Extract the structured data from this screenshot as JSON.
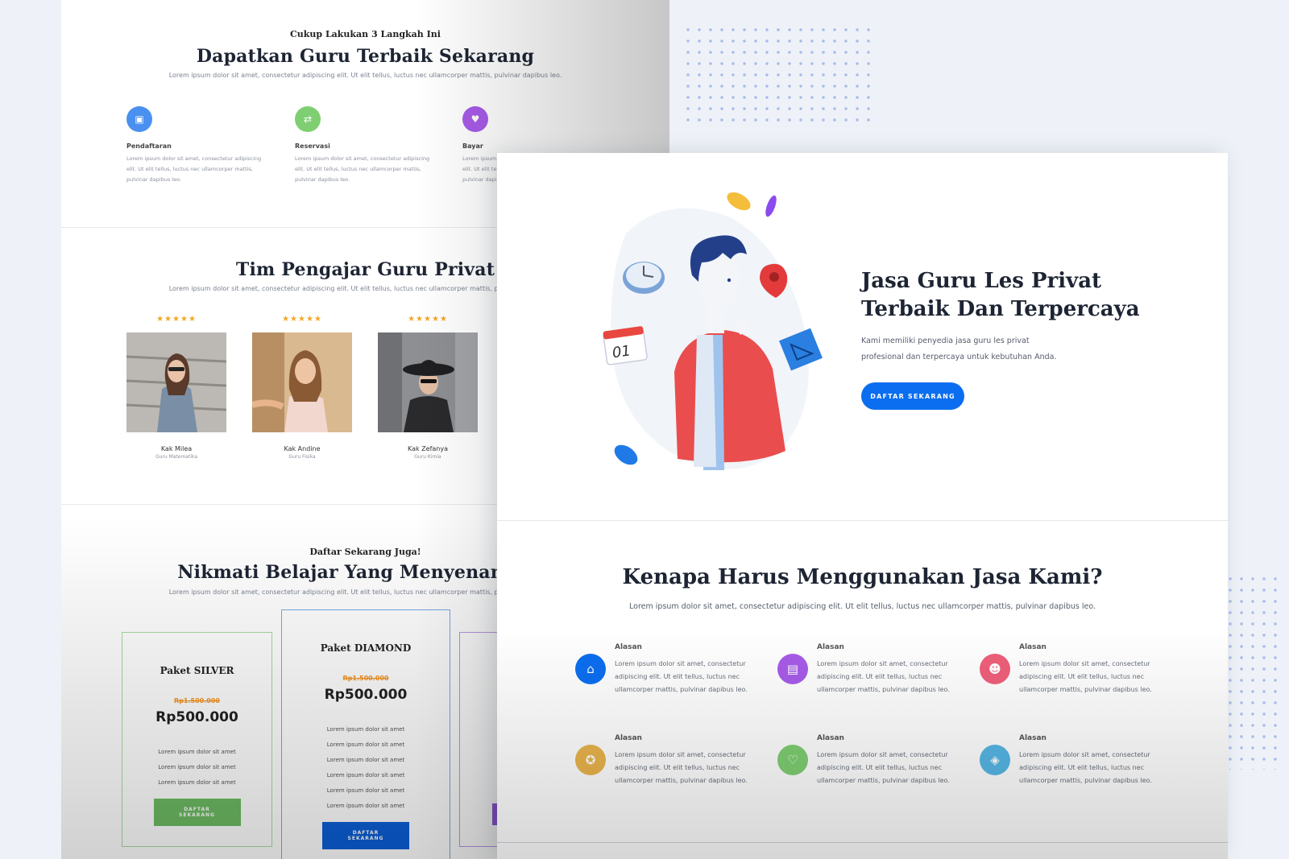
{
  "back_page": {
    "steps": {
      "kicker": "Cukup Lakukan 3 Langkah Ini",
      "title": "Dapatkan Guru Terbaik Sekarang",
      "subtitle": "Lorem ipsum dolor sit amet, consectetur adipiscing elit. Ut elit tellus, luctus nec ullamcorper mattis, pulvinar dapibus leo.",
      "items": [
        {
          "title": "Pendaftaran",
          "text": "Lorem ipsum dolor sit amet, consectetur adipiscing elit. Ut elit tellus, luctus nec ullamcorper mattis, pulvinar dapibus leo.",
          "icon": "id-card-icon",
          "color": "#4a90f0"
        },
        {
          "title": "Reservasi",
          "text": "Lorem ipsum dolor sit amet, consectetur adipiscing elit. Ut elit tellus, luctus nec ullamcorper mattis, pulvinar dapibus leo.",
          "icon": "handshake-icon",
          "color": "#7fcf72"
        },
        {
          "title": "Bayar",
          "text": "Lorem ipsum dolor sit amet, consectetur adipiscing elit. Ut elit tellus, luctus nec ullamcorper mattis, pulvinar dapibus leo.",
          "icon": "heart-icon",
          "color": "#a75be8"
        }
      ]
    },
    "team": {
      "title": "Tim Pengajar Guru Privat",
      "subtitle": "Lorem ipsum dolor sit amet, consectetur adipiscing elit. Ut elit tellus, luctus nec ullamcorper mattis, pulvinar dapibus leo.",
      "stars": "★★★★★",
      "teachers": [
        {
          "name": "Kak Milea",
          "role": "Guru Matematika"
        },
        {
          "name": "Kak Andine",
          "role": "Guru Fisika"
        },
        {
          "name": "Kak Zefanya",
          "role": "Guru Kimia"
        }
      ]
    },
    "pricing": {
      "kicker": "Daftar Sekarang Juga!",
      "title": "Nikmati Belajar Yang Menyenangkan",
      "subtitle": "Lorem ipsum dolor sit amet, consectetur adipiscing elit. Ut elit tellus, luctus nec ullamcorper mattis, pulvinar dapibus leo.",
      "feature": "Lorem ipsum dolor sit amet",
      "plans": [
        {
          "name": "Paket SILVER",
          "old_price": "Rp1.500.000",
          "price": "Rp500.000",
          "button": "DAFTAR SEKARANG",
          "accent": "#6dbb63"
        },
        {
          "name": "Paket DIAMOND",
          "old_price": "Rp1.500.000",
          "price": "Rp500.000",
          "button": "DAFTAR SEKARANG",
          "accent": "#0b5ed7"
        }
      ]
    }
  },
  "front_page": {
    "hero": {
      "title_line1": "Jasa Guru Les Privat",
      "title_line2": "Terbaik Dan Terpercaya",
      "subtitle_line1": "Kami memiliki penyedia jasa guru les privat",
      "subtitle_line2": "profesional dan terpercaya untuk kebutuhan Anda.",
      "button": "DAFTAR SEKARANG",
      "calendar_day": "01"
    },
    "why": {
      "title": "Kenapa Harus Menggunakan Jasa Kami?",
      "subtitle": "Lorem ipsum dolor sit amet, consectetur adipiscing elit. Ut elit tellus, luctus nec ullamcorper mattis, pulvinar dapibus leo.",
      "reason_text": "Lorem ipsum dolor sit amet, consectetur adipiscing elit. Ut elit tellus, luctus nec ullamcorper mattis, pulvinar dapibus leo.",
      "reasons": [
        {
          "title": "Alasan",
          "icon": "home-icon",
          "color": "#0b6ef0",
          "glyph": "⌂"
        },
        {
          "title": "Alasan",
          "icon": "document-icon",
          "color": "#a75be8",
          "glyph": "▤"
        },
        {
          "title": "Alasan",
          "icon": "user-icon",
          "color": "#ef5f7a",
          "glyph": "☻"
        },
        {
          "title": "Alasan",
          "icon": "medal-icon",
          "color": "#e9b44c",
          "glyph": "✪"
        },
        {
          "title": "Alasan",
          "icon": "heart-icon",
          "color": "#7fcf72",
          "glyph": "♡"
        },
        {
          "title": "Alasan",
          "icon": "tag-icon",
          "color": "#56b7e6",
          "glyph": "◈"
        }
      ]
    }
  },
  "colors": {
    "primary": "#0b6ef0",
    "heading": "#1d2433",
    "background": "#eef2f8"
  }
}
